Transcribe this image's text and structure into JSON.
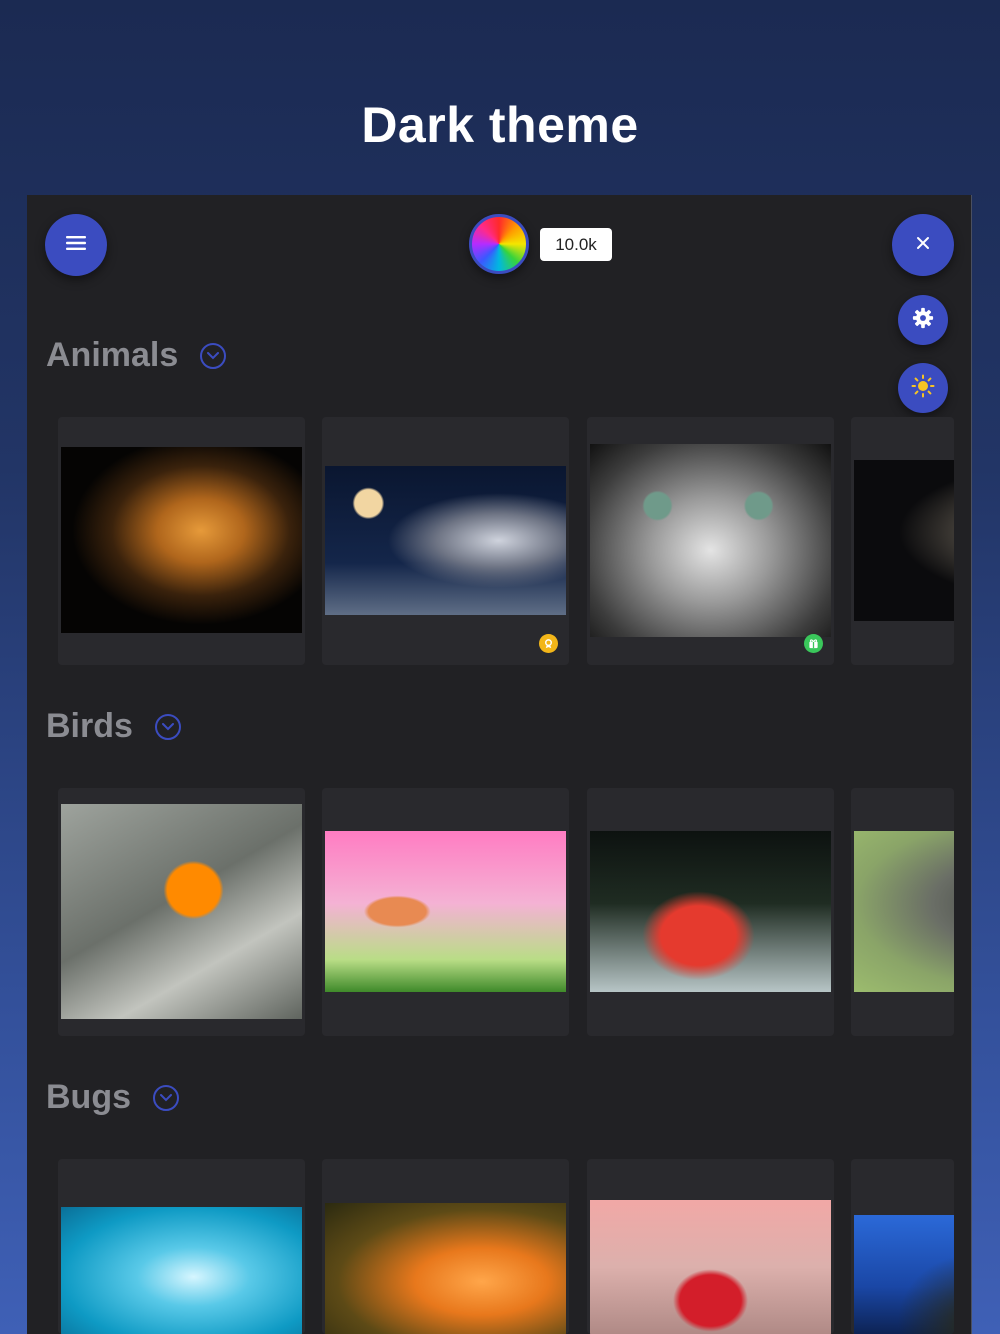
{
  "marketing": {
    "title": "Dark theme"
  },
  "header": {
    "counter_value": "10.0k"
  },
  "icons": {
    "menu": "hamburger-icon",
    "palette": "color-wheel-icon",
    "close": "close-icon",
    "settings": "gear-icon",
    "theme": "sun-icon",
    "section_toggle": "chevron-down-circle-icon",
    "badge_gold": "award-icon",
    "badge_green": "gift-icon"
  },
  "colors": {
    "background_top": "#1b2a52",
    "background_bottom": "#3f60b6",
    "app_background": "#212124",
    "card_background": "#29292d",
    "accent": "#3b4cc0",
    "section_title": "#8b8c92",
    "badge_gold": "#f3b619",
    "badge_green": "#3ac75b",
    "sun": "#f7c424"
  },
  "sections": [
    {
      "title": "Animals",
      "items": [
        {
          "name": "tiger"
        },
        {
          "name": "wolves-moon",
          "badge": "award"
        },
        {
          "name": "cat",
          "badge": "gift"
        },
        {
          "name": "white-tiger"
        }
      ]
    },
    {
      "title": "Birds",
      "items": [
        {
          "name": "oriole"
        },
        {
          "name": "bullfinch"
        },
        {
          "name": "sunbird"
        },
        {
          "name": "owl"
        }
      ]
    },
    {
      "title": "Bugs",
      "items": [
        {
          "name": "butterfly-blue"
        },
        {
          "name": "butterfly-flowers"
        },
        {
          "name": "ladybug"
        },
        {
          "name": "blue-field"
        }
      ]
    }
  ]
}
